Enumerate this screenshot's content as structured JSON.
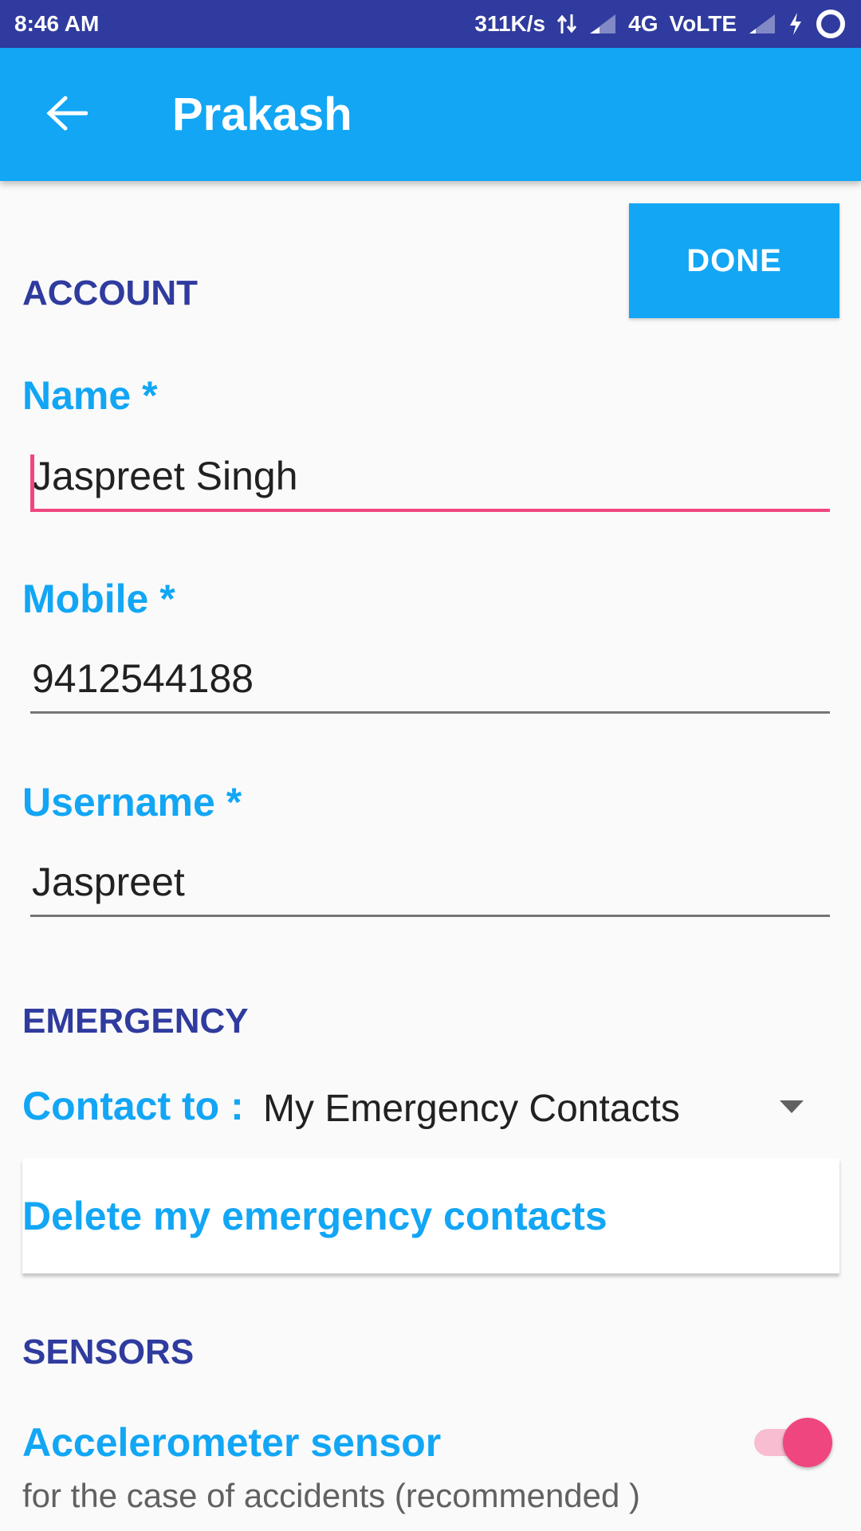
{
  "status_bar": {
    "time": "8:46 AM",
    "speed": "311K/s",
    "network": "4G",
    "volte": "VoLTE"
  },
  "app_bar": {
    "title": "Prakash"
  },
  "toolbar": {
    "done_label": "DONE"
  },
  "sections": {
    "account": "ACCOUNT",
    "emergency": "EMERGENCY",
    "sensors": "SENSORS"
  },
  "account": {
    "name_label": "Name *",
    "name_value": "Jaspreet Singh",
    "mobile_label": "Mobile *",
    "mobile_value": "9412544188",
    "username_label": "Username *",
    "username_value": "Jaspreet"
  },
  "emergency": {
    "contact_label": "Contact to :",
    "contact_value": "My Emergency Contacts",
    "delete_label": "Delete my emergency contacts"
  },
  "sensors": {
    "accelerometer_title": "Accelerometer sensor",
    "accelerometer_subtitle": "for the case of accidents (recommended )",
    "accelerometer_enabled": true
  },
  "colors": {
    "status_bar": "#2f3b9e",
    "app_bar": "#12a6f5",
    "accent": "#f0467f",
    "section_header": "#2f3b9e"
  }
}
